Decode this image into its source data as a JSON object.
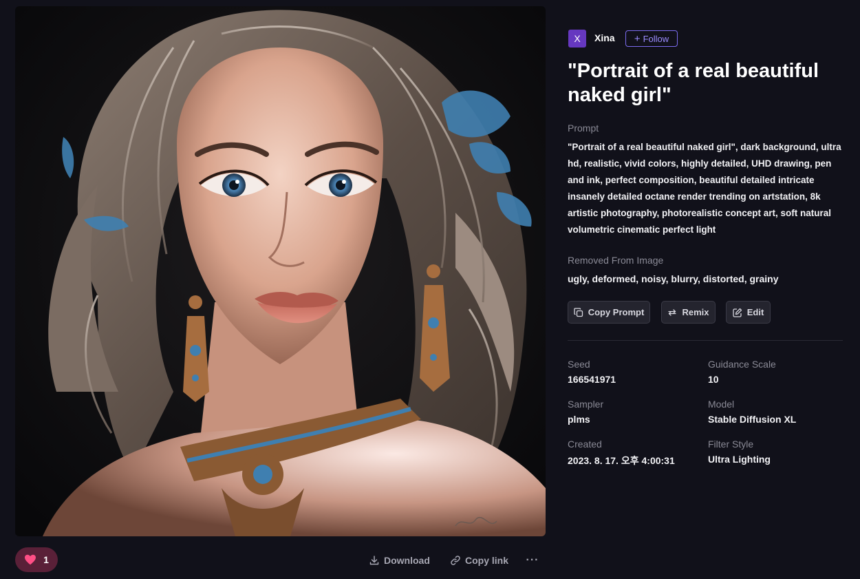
{
  "author": {
    "initial": "X",
    "name": "Xina",
    "follow_label": "Follow"
  },
  "title": "\"Portrait of a real beautiful naked girl\"",
  "prompt": {
    "label": "Prompt",
    "text": "\"Portrait of a real beautiful naked girl\", dark background, ultra hd, realistic, vivid colors, highly detailed, UHD drawing, pen and ink, perfect composition, beautiful detailed intricate insanely detailed octane render trending on artstation, 8k artistic photography, photorealistic concept art, soft natural volumetric cinematic perfect light"
  },
  "removed": {
    "label": "Removed From Image",
    "text": "ugly, deformed, noisy, blurry, distorted, grainy"
  },
  "actions": {
    "copy_prompt": "Copy Prompt",
    "remix": "Remix",
    "edit": "Edit"
  },
  "meta": {
    "seed_label": "Seed",
    "seed": "166541971",
    "guidance_label": "Guidance Scale",
    "guidance": "10",
    "sampler_label": "Sampler",
    "sampler": "plms",
    "model_label": "Model",
    "model": "Stable Diffusion XL",
    "created_label": "Created",
    "created": "2023. 8. 17. 오후 4:00:31",
    "filter_label": "Filter Style",
    "filter": "Ultra Lighting"
  },
  "footer": {
    "like_count": "1",
    "download": "Download",
    "copy_link": "Copy link",
    "more": "···"
  },
  "colors": {
    "background": "#11111a",
    "accent": "#7b6cf0",
    "like_bg": "#5a2038",
    "like_heart": "#ff4f86"
  },
  "icons": [
    "heart-icon",
    "download-icon",
    "link-icon",
    "more-icon",
    "copy-icon",
    "remix-icon",
    "edit-icon",
    "plus-icon"
  ]
}
